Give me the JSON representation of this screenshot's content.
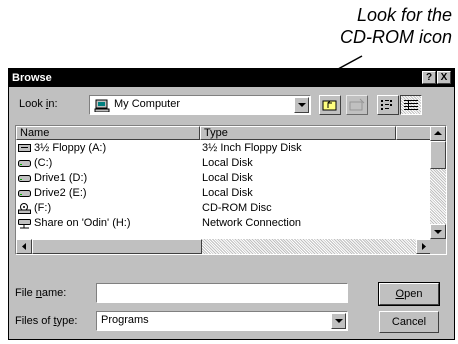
{
  "callout": {
    "line1": "Look for the",
    "line2": "CD-ROM icon"
  },
  "dialog": {
    "title": "Browse",
    "help_glyph": "?",
    "close_glyph": "X",
    "look_in": {
      "label_pre": "Look ",
      "label_key": "i",
      "label_post": "n:",
      "value": "My Computer"
    },
    "columns": {
      "name": "Name",
      "type": "Type"
    },
    "rows": [
      {
        "name": "3½ Floppy (A:)",
        "type": "3½ Inch Floppy Disk",
        "icon": "floppy-drive-icon"
      },
      {
        "name": "(C:)",
        "type": "Local Disk",
        "icon": "hard-drive-icon"
      },
      {
        "name": "Drive1 (D:)",
        "type": "Local Disk",
        "icon": "hard-drive-icon"
      },
      {
        "name": "Drive2 (E:)",
        "type": "Local Disk",
        "icon": "hard-drive-icon"
      },
      {
        "name": "(F:)",
        "type": "CD-ROM Disc",
        "icon": "cdrom-drive-icon"
      },
      {
        "name": "Share on 'Odin' (H:)",
        "type": "Network Connection",
        "icon": "network-drive-icon"
      }
    ],
    "file_name": {
      "label_pre": "File ",
      "label_key": "n",
      "label_post": "ame:",
      "value": ""
    },
    "file_type": {
      "label_pre": "Files of ",
      "label_key": "t",
      "label_post": "ype:",
      "value": "Programs"
    },
    "buttons": {
      "open_key": "O",
      "open_rest": "pen",
      "cancel": "Cancel"
    }
  }
}
